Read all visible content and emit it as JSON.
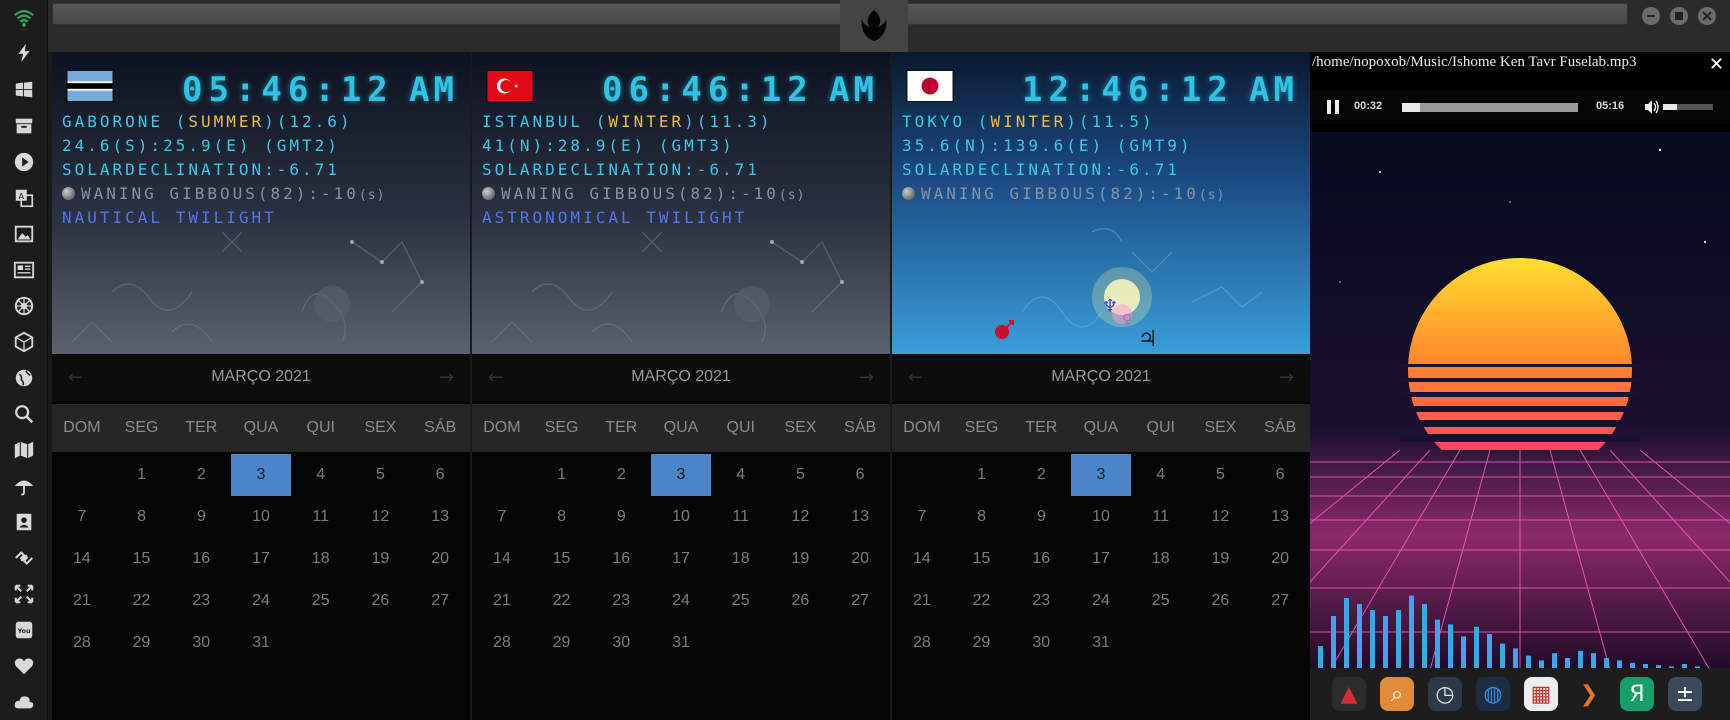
{
  "sidebar": {
    "icons": [
      "wifi-icon",
      "lightning-icon",
      "windows-icon",
      "archive-icon",
      "play-icon",
      "translate-icon",
      "image-icon",
      "news-icon",
      "empire-icon",
      "cube-icon",
      "globe-icon",
      "search-icon",
      "map-icon",
      "umbrella-icon",
      "contacts-icon",
      "link-icon",
      "fullscreen-icon",
      "youtube-icon",
      "heart-icon",
      "cloud-icon"
    ],
    "accent": "#27ae60"
  },
  "clocks": [
    {
      "flag": "botswana",
      "time": "05:46:12",
      "ampm": "AM",
      "city": "GABORONE",
      "season": "SUMMER",
      "city_extra": "(12.6)",
      "coords": "24.6(S):25.9(E) (GMT2)",
      "declination": "SOLARDECLINATION:-6.71",
      "moon": "WANING GIBBOUS(82):-10",
      "moon_unit": "(s)",
      "twilight": "NAUTICAL TWILIGHT",
      "scene": "night"
    },
    {
      "flag": "turkey",
      "time": "06:46:12",
      "ampm": "AM",
      "city": "ISTANBUL",
      "season": "WINTER",
      "city_extra": "(11.3)",
      "coords": "41(N):28.9(E) (GMT3)",
      "declination": "SOLARDECLINATION:-6.71",
      "moon": "WANING GIBBOUS(82):-10",
      "moon_unit": "(s)",
      "twilight": "ASTRONOMICAL TWILIGHT",
      "scene": "night"
    },
    {
      "flag": "japan",
      "time": "12:46:12",
      "ampm": "AM",
      "city": "TOKYO",
      "season": "WINTER",
      "city_extra": "(11.5)",
      "coords": "35.6(N):139.6(E) (GMT9)",
      "declination": "SOLARDECLINATION:-6.71",
      "moon": "WANING GIBBOUS(82):-10",
      "moon_unit": "(s)",
      "twilight": "",
      "scene": "day"
    }
  ],
  "calendar": {
    "month_label": "MARÇO 2021",
    "weekdays": [
      "DOM",
      "SEG",
      "TER",
      "QUA",
      "QUI",
      "SEX",
      "SÁB"
    ],
    "days_in_month": 31,
    "first_weekday_index": 1,
    "selected_day": 3,
    "prev_arrow": "←",
    "next_arrow": "→"
  },
  "player": {
    "path": "/home/nopoxob/Music/Ishome Ken Tavr Fuselab.mp3",
    "close": "✕",
    "elapsed": "00:32",
    "duration": "05:16",
    "progress_fraction": 0.1,
    "volume_fraction": 0.28,
    "spectrum": [
      0.2,
      0.45,
      0.6,
      0.55,
      0.5,
      0.45,
      0.5,
      0.62,
      0.55,
      0.42,
      0.38,
      0.28,
      0.36,
      0.3,
      0.22,
      0.18,
      0.12,
      0.08,
      0.14,
      0.1,
      0.16,
      0.14,
      0.1,
      0.08,
      0.06,
      0.05,
      0.04,
      0.03,
      0.05,
      0.03
    ],
    "dock_apps": [
      {
        "name": "dock-app-red-arrow",
        "color": "#2c2c2c",
        "glyph": "▲",
        "glyph_color": "#d23030"
      },
      {
        "name": "dock-app-search",
        "color": "#e08a3a",
        "glyph": "⌕",
        "glyph_color": "#ffffff"
      },
      {
        "name": "dock-app-clock",
        "color": "#2b3a48",
        "glyph": "◷",
        "glyph_color": "#dfe6ee"
      },
      {
        "name": "dock-app-globe",
        "color": "#1b2c44",
        "glyph": "◍",
        "glyph_color": "#3a8ee0"
      },
      {
        "name": "dock-app-calendar",
        "color": "#eeeeee",
        "glyph": "▦",
        "glyph_color": "#d23030"
      },
      {
        "name": "dock-app-play",
        "color": "#1d1d1d",
        "glyph": "❯",
        "glyph_color": "#e8722a"
      },
      {
        "name": "dock-app-yandex",
        "color": "#15a06a",
        "glyph": "Я",
        "glyph_color": "#ffffff"
      },
      {
        "name": "dock-app-calculator",
        "color": "#3a4a5a",
        "glyph": "±",
        "glyph_color": "#ffffff"
      }
    ]
  }
}
